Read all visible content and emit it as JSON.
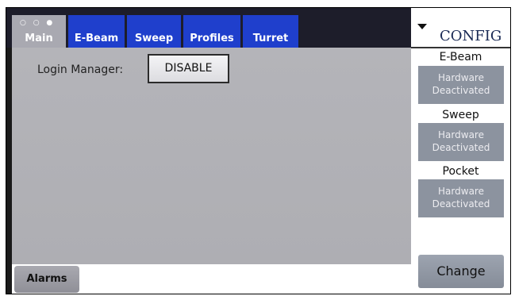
{
  "tabs": [
    {
      "label": "Main",
      "active": true,
      "indicator": "○ ○ ●"
    },
    {
      "label": "E-Beam",
      "active": false
    },
    {
      "label": "Sweep",
      "active": false
    },
    {
      "label": "Profiles",
      "active": false
    },
    {
      "label": "Turret",
      "active": false
    }
  ],
  "main": {
    "login_label": "Login Manager:",
    "disable_label": "DISABLE"
  },
  "bottom": {
    "alarms_label": "Alarms"
  },
  "config": {
    "title": "CONFIG",
    "dropdown_icon": "chevron-down-icon",
    "sections": [
      {
        "label": "E-Beam",
        "status": [
          "Hardware",
          "Deactivated"
        ]
      },
      {
        "label": "Sweep",
        "status": [
          "Hardware",
          "Deactivated"
        ]
      },
      {
        "label": "Pocket",
        "status": [
          "Hardware",
          "Deactivated"
        ]
      }
    ],
    "change_label": "Change"
  },
  "colors": {
    "tab_blue": "#1f3fcc",
    "tab_active": "#a9a9b1",
    "panel_gray": "#b1b1b6",
    "status_box": "#8c939f"
  }
}
